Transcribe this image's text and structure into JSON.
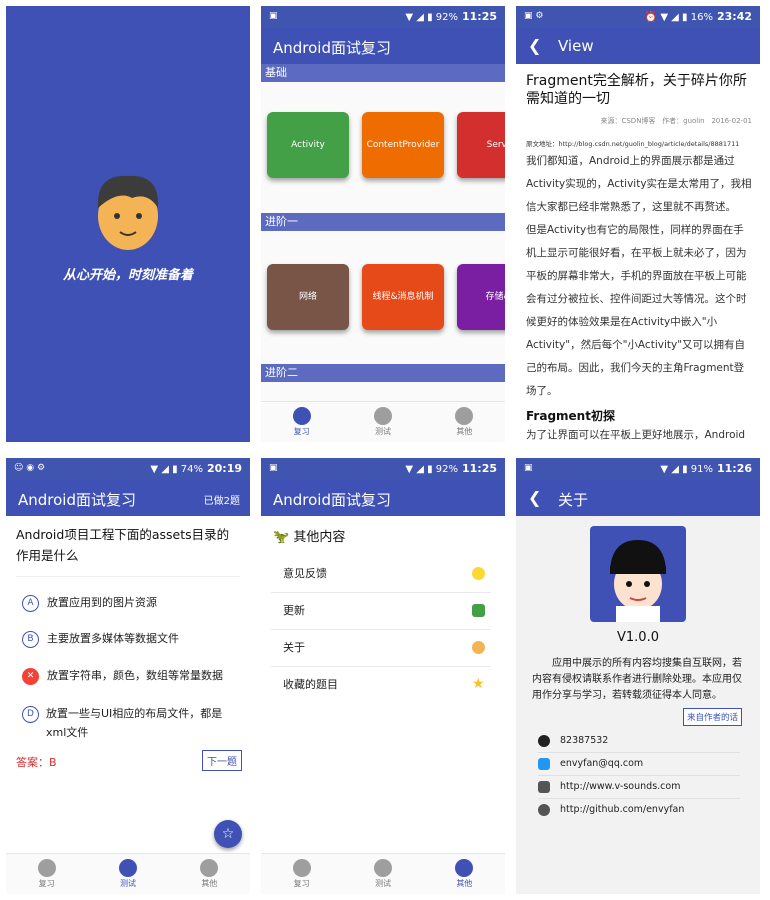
{
  "colors": {
    "primary": "#3f51b5",
    "section": "#5c6bc0",
    "wrong": "#f44336",
    "answer": "#d32f2f"
  },
  "splash": {
    "slogan": "从心开始，时刻准备着"
  },
  "home": {
    "status": {
      "battery": "92%",
      "time": "11:25"
    },
    "title": "Android面试复习",
    "sections": [
      {
        "label": "基础",
        "cards": [
          "Activity",
          "ContentProvider",
          "Servi"
        ]
      },
      {
        "label": "进阶一",
        "cards": [
          "网络",
          "线程&消息机制",
          "存储&"
        ]
      },
      {
        "label": "进阶二"
      }
    ]
  },
  "article": {
    "status": {
      "battery": "16%",
      "time": "23:42"
    },
    "title": "View",
    "heading": "Fragment完全解析，关于碎片你所需知道的一切",
    "meta": {
      "source": "来源：CSDN博客",
      "author": "作者：guolin",
      "date": "2016-02-01"
    },
    "url": "原文地址：http://blog.csdn.net/guolin_blog/article/details/8881711",
    "paragraphs": [
      "我们都知道，Android上的界面展示都是通过Activity实现的，Activity实在是太常用了，我相信大家都已经非常熟悉了，这里就不再赘述。",
      "但是Activity也有它的局限性，同样的界面在手机上显示可能很好看，在平板上就未必了，因为平板的屏幕非常大，手机的界面放在平板上可能会有过分被拉长、控件间距过大等情况。这个时候更好的体验效果是在Activity中嵌入\"小Activity\"，然后每个\"小Activity\"又可以拥有自己的布局。因此，我们今天的主角Fragment登场了。"
    ],
    "subheading": "Fragment初探",
    "tail": "为了让界面可以在平板上更好地展示，Android在"
  },
  "quiz": {
    "status": {
      "battery": "74%",
      "time": "20:19"
    },
    "title": "Android面试复习",
    "counter": "已做2题",
    "question": "Android项目工程下面的assets目录的作用是什么",
    "options": [
      {
        "letter": "A",
        "text": "放置应用到的图片资源"
      },
      {
        "letter": "B",
        "text": "主要放置多媒体等数据文件"
      },
      {
        "letter": "✕",
        "text": "放置字符串，颜色，数组等常量数据"
      },
      {
        "letter": "D",
        "text": "放置一些与UI相应的布局文件，都是xml文件"
      }
    ],
    "answer": "答案：B",
    "next": "下一题"
  },
  "other": {
    "status": {
      "battery": "92%",
      "time": "11:25"
    },
    "title": "Android面试复习",
    "heading": "其他内容",
    "items": [
      "意见反馈",
      "更新",
      "关于",
      "收藏的题目"
    ]
  },
  "about": {
    "status": {
      "battery": "91%",
      "time": "11:26"
    },
    "title": "关于",
    "version": "V1.0.0",
    "desc": "应用中展示的所有内容均搜集自互联网，若内容有侵权请联系作者进行删除处理。本应用仅用作分享与学习，若转载须征得本人同意。",
    "author_button": "来自作者的话",
    "contacts": [
      "82387532",
      "envyfan@qq.com",
      "http://www.v-sounds.com",
      "http://github.com/envyfan"
    ]
  },
  "nav": {
    "review": "复习",
    "test": "测试",
    "other": "其他"
  }
}
